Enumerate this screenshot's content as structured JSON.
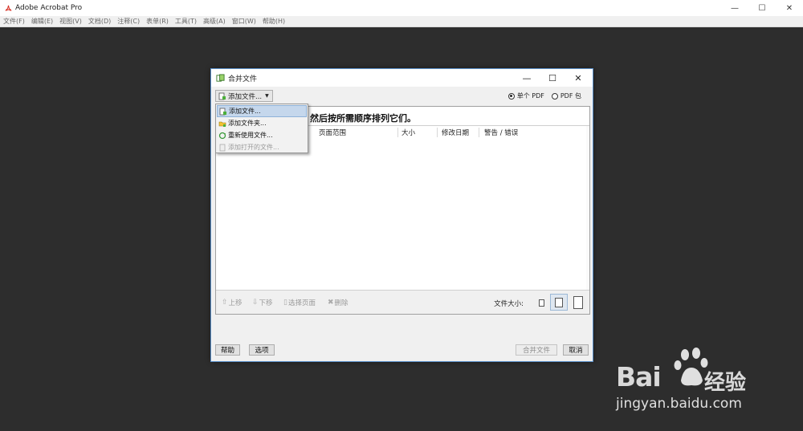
{
  "app": {
    "title": "Adobe Acrobat Pro",
    "window_controls": {
      "minimize": "—",
      "maximize": "☐",
      "close": "✕"
    }
  },
  "menubar": {
    "items": [
      "文件(F)",
      "编辑(E)",
      "视图(V)",
      "文档(D)",
      "注释(C)",
      "表单(R)",
      "工具(T)",
      "高级(A)",
      "窗口(W)",
      "帮助(H)"
    ]
  },
  "dialog": {
    "title": "合并文件",
    "controls": {
      "minimize": "—",
      "maximize": "☐",
      "close": "✕"
    },
    "add_files_label": "添加文件...",
    "radio_single_pdf": "单个 PDF",
    "radio_pdf_package": "PDF 包",
    "radio_selected": "single_pdf",
    "instruction_text": "然后按所需顺序排列它们。",
    "columns": [
      "页面范围",
      "大小",
      "修改日期",
      "警告 / 错误"
    ],
    "bottom": {
      "move_up": "上移",
      "move_down": "下移",
      "choose_pages": "选择页面",
      "delete": "删除",
      "file_size_label": "文件大小:"
    },
    "footer": {
      "help": "帮助",
      "options": "选项",
      "combine": "合并文件",
      "cancel": "取消"
    }
  },
  "dropdown": {
    "items": [
      {
        "label": "添加文件...",
        "icon": "add-file-icon",
        "state": "hover"
      },
      {
        "label": "添加文件夹...",
        "icon": "add-folder-icon",
        "state": "normal"
      },
      {
        "label": "重新使用文件...",
        "icon": "reuse-files-icon",
        "state": "normal"
      },
      {
        "label": "添加打开的文件...",
        "icon": "add-open-files-icon",
        "state": "disabled"
      }
    ]
  },
  "watermark": {
    "brand": "Bai",
    "brand_suffix": "经验",
    "url": "jingyan.baidu.com"
  },
  "colors": {
    "workspace": "#2d2d2d",
    "dialog_border": "#5a8fc9",
    "acrobat_red": "#d62a1e",
    "hover_blue": "#c5d7ec"
  }
}
